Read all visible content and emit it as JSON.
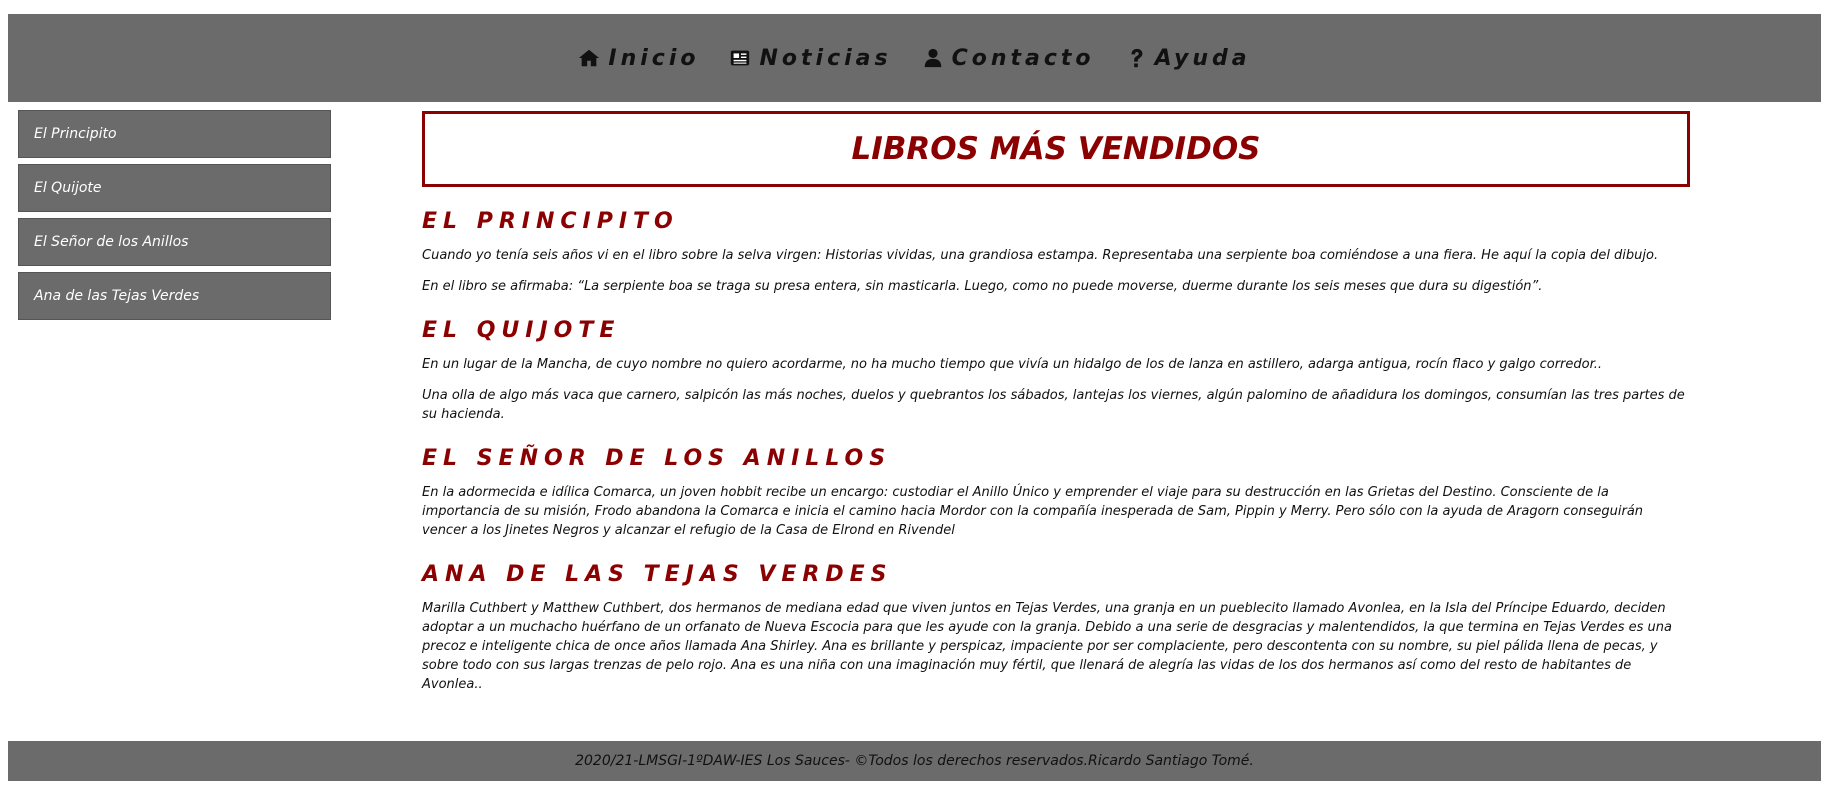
{
  "nav": {
    "items": [
      {
        "label": "Inicio",
        "icon": "home-icon"
      },
      {
        "label": "Noticias",
        "icon": "newspaper-icon"
      },
      {
        "label": "Contacto",
        "icon": "user-icon"
      },
      {
        "label": "Ayuda",
        "icon": "question-icon"
      }
    ]
  },
  "sidebar": {
    "items": [
      {
        "label": "El Principito"
      },
      {
        "label": "El Quijote"
      },
      {
        "label": "El Señor de los Anillos"
      },
      {
        "label": "Ana de las Tejas Verdes"
      }
    ]
  },
  "main": {
    "title": "LIBROS MÁS VENDIDOS",
    "sections": [
      {
        "heading": "EL PRINCIPITO",
        "paragraphs": [
          "Cuando yo tenía seis años vi en el libro sobre la selva virgen: Historias vividas, una grandiosa estampa. Representaba una serpiente boa comiéndose a una fiera. He aquí la copia del dibujo.",
          "En el libro se afirmaba: “La serpiente boa se traga su presa entera, sin masticarla. Luego, como no puede moverse, duerme durante los seis meses que dura su digestión”."
        ]
      },
      {
        "heading": "EL QUIJOTE",
        "paragraphs": [
          "En un lugar de la Mancha, de cuyo nombre no quiero acordarme, no ha mucho tiempo que vivía un hidalgo de los de lanza en astillero, adarga antigua, rocín flaco y galgo corredor..",
          "Una olla de algo más vaca que carnero, salpicón las más noches, duelos y quebrantos los sábados, lantejas los viernes, algún palomino de añadidura los domingos, consumían las tres partes de su hacienda."
        ]
      },
      {
        "heading": "EL SEÑOR DE LOS ANILLOS",
        "paragraphs": [
          "En la adormecida e idílica Comarca, un joven hobbit recibe un encargo: custodiar el Anillo Único y emprender el viaje para su destrucción en las Grietas del Destino. Consciente de la importancia de su misión, Frodo abandona la Comarca e inicia el camino hacia Mordor con la compañía inesperada de Sam, Pippin y Merry. Pero sólo con la ayuda de Aragorn conseguirán vencer a los Jinetes Negros y alcanzar el refugio de la Casa de Elrond en Rivendel"
        ]
      },
      {
        "heading": "ANA DE LAS TEJAS VERDES",
        "paragraphs": [
          "Marilla Cuthbert y Matthew Cuthbert, dos hermanos de mediana edad que viven juntos en Tejas Verdes, una granja en un pueblecito llamado Avonlea, en la Isla del Príncipe Eduardo, deciden adoptar a un muchacho huérfano de un orfanato de Nueva Escocia para que les ayude con la granja. Debido a una serie de desgracias y malentendidos, la que termina en Tejas Verdes es una precoz e inteligente chica de once años llamada Ana Shirley. Ana es brillante y perspicaz, impaciente por ser complaciente, pero descontenta con su nombre, su piel pálida llena de pecas, y sobre todo con sus largas trenzas de pelo rojo. Ana es una niña con una imaginación muy fértil, que llenará de alegría las vidas de los dos hermanos así como del resto de habitantes de Avonlea.."
        ]
      }
    ]
  },
  "footer": {
    "text": "2020/21-LMSGI-1ºDAW-IES Los Sauces- ©Todos los derechos reservados.Ricardo Santiago Tomé."
  },
  "colors": {
    "bar_gray": "#6b6b6b",
    "accent_red": "#8b0000"
  }
}
